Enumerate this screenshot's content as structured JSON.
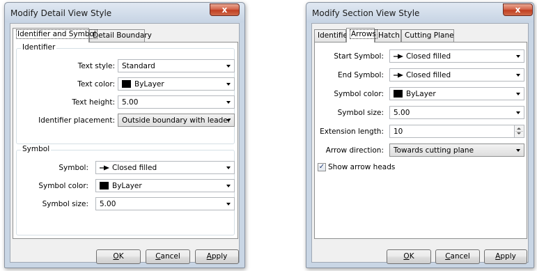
{
  "left_dialog": {
    "title": "Modify Detail View Style",
    "close_glyph": "x",
    "tabs": [
      "Identifier and Symbol",
      "Detail Boundary"
    ],
    "identifier_group": {
      "label": "Identifier",
      "text_style_label": "Text style:",
      "text_style_value": "Standard",
      "text_color_label": "Text color:",
      "text_color_value": "ByLayer",
      "text_height_label": "Text height:",
      "text_height_value": "5.00",
      "placement_label": "Identifier placement:",
      "placement_value": "Outside boundary with leader"
    },
    "symbol_group": {
      "label": "Symbol",
      "symbol_label": "Symbol:",
      "symbol_value": "Closed filled",
      "symbol_color_label": "Symbol color:",
      "symbol_color_value": "ByLayer",
      "symbol_size_label": "Symbol size:",
      "symbol_size_value": "5.00"
    },
    "buttons": {
      "ok_key": "O",
      "ok_rest": "K",
      "cancel_key": "C",
      "cancel_rest": "ancel",
      "apply_key": "A",
      "apply_rest": "pply"
    }
  },
  "right_dialog": {
    "title": "Modify Section View Style",
    "close_glyph": "x",
    "tabs": [
      "Identifier",
      "Arrows",
      "Hatch",
      "Cutting Plane"
    ],
    "arrows": {
      "start_symbol_label": "Start Symbol:",
      "start_symbol_value": "Closed filled",
      "end_symbol_label": "End Symbol:",
      "end_symbol_value": "Closed filled",
      "symbol_color_label": "Symbol color:",
      "symbol_color_value": "ByLayer",
      "symbol_size_label": "Symbol size:",
      "symbol_size_value": "5.00",
      "extension_label": "Extension length:",
      "extension_value": "10",
      "direction_label": "Arrow direction:",
      "direction_value": "Towards cutting plane",
      "show_heads_label": "Show arrow heads",
      "show_heads_checked": true
    },
    "buttons": {
      "ok_key": "O",
      "ok_rest": "K",
      "cancel_key": "C",
      "cancel_rest": "ancel",
      "apply_key": "A",
      "apply_rest": "pply"
    }
  },
  "colors": {
    "frame": "#c9d6e5",
    "close_button": "#c13f22",
    "swatch": "#000000"
  }
}
